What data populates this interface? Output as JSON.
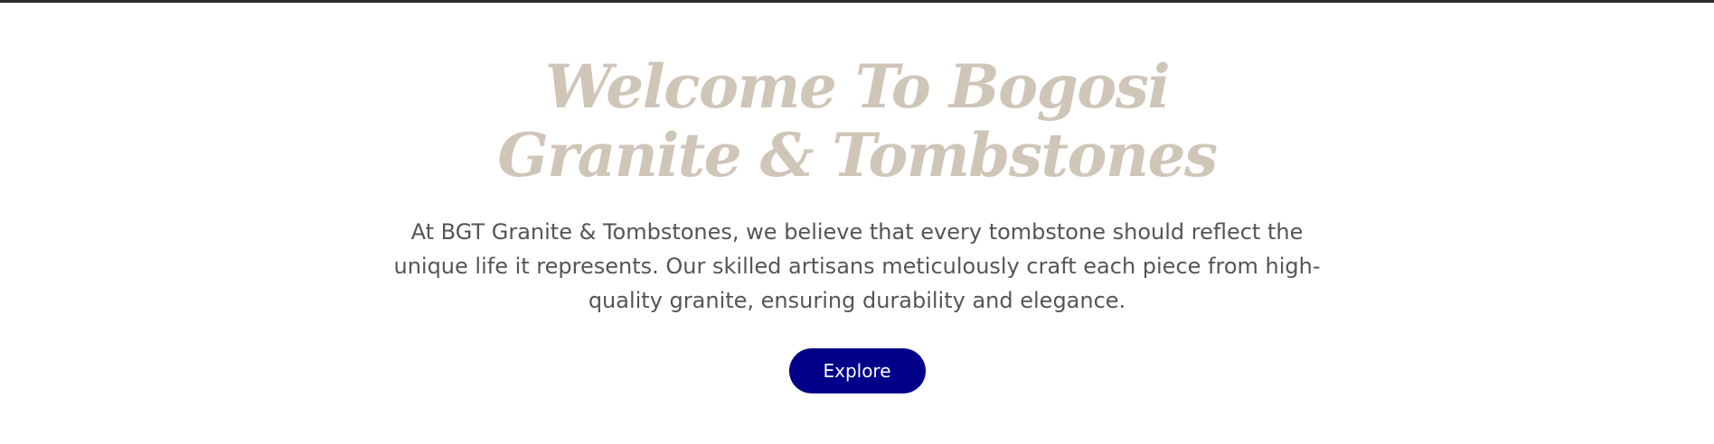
{
  "hero": {
    "title": "Welcome To Bogosi Granite & Tombstones",
    "description": "At BGT Granite & Tombstones, we believe that every tombstone should reflect the unique life it represents. Our skilled artisans meticulously craft each piece from high-quality granite, ensuring durability and elegance.",
    "explore_label": "Explore"
  },
  "colors": {
    "title": "#cfc6b8",
    "text": "#555555",
    "button_bg": "#020089",
    "button_text": "#ffffff",
    "top_border": "#2b2b2b"
  }
}
